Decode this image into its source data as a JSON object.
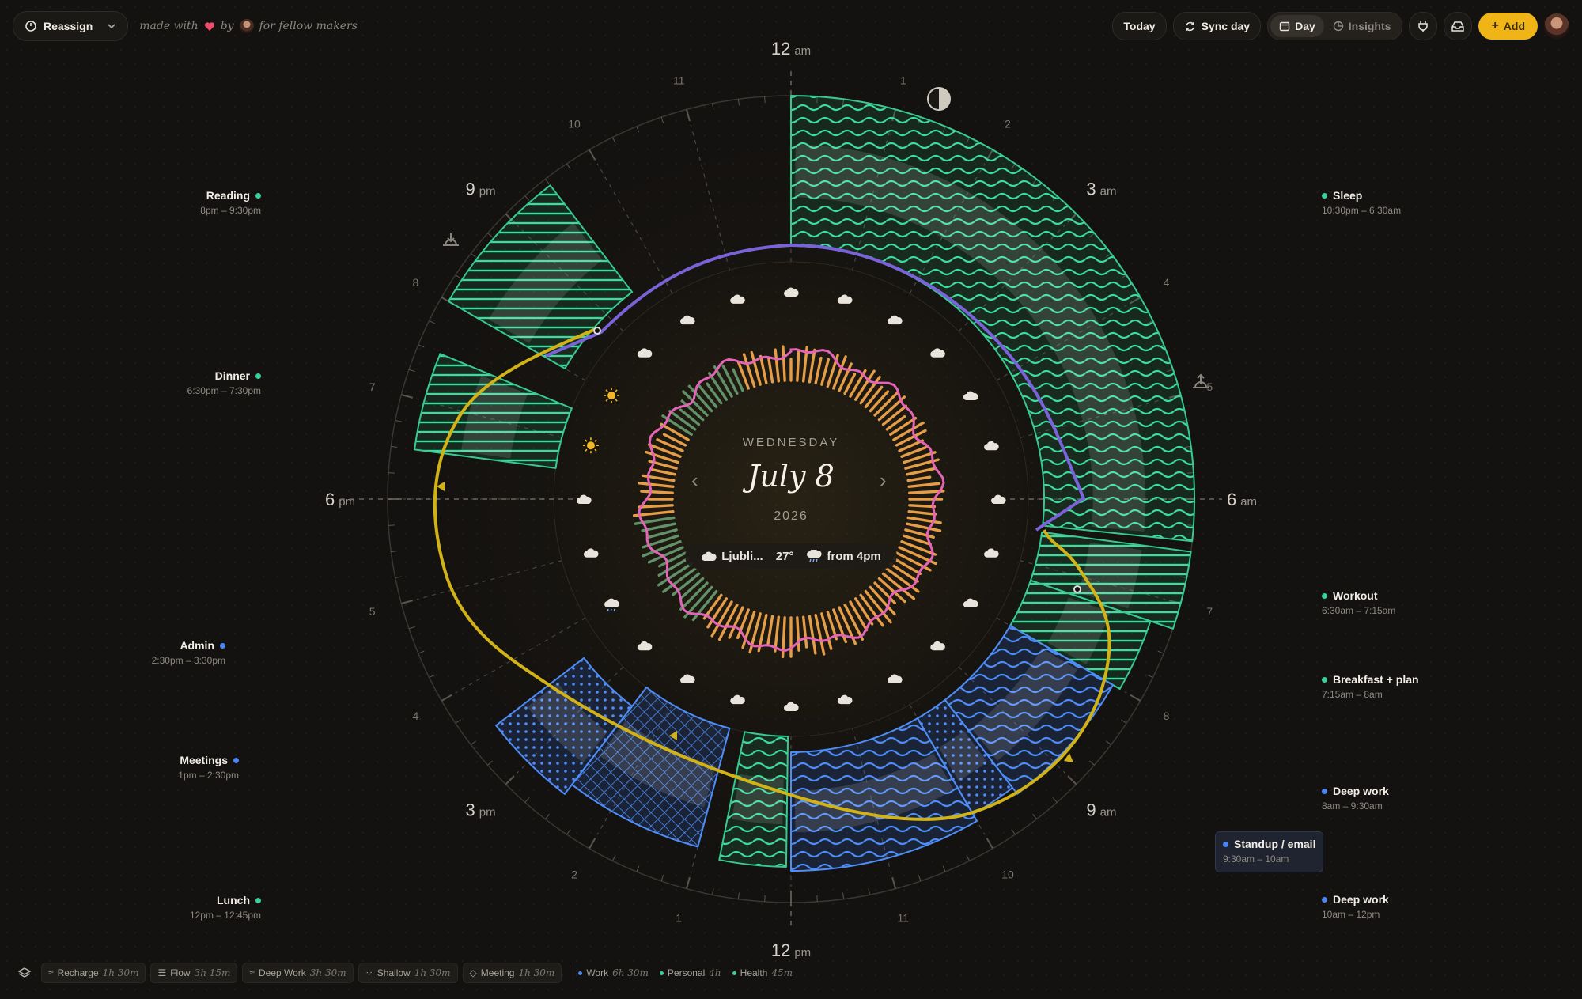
{
  "header": {
    "reassign_label": "Reassign",
    "made_with": "made with",
    "by": "by",
    "for_makers": "for fellow makers",
    "today_label": "Today",
    "sync_label": "Sync day",
    "view_day": "Day",
    "view_insights": "Insights",
    "add_label": "Add"
  },
  "clock": {
    "top_hour": "12",
    "top_suffix": "am",
    "bottom_hour": "12",
    "bottom_suffix": "pm",
    "right_hour": "6",
    "right_suffix": "am",
    "left_hour": "6",
    "left_suffix": "pm",
    "h3am": "3",
    "h3am_s": "am",
    "h9am": "9",
    "h9am_s": "am",
    "h3pm": "3",
    "h3pm_s": "pm",
    "h9pm": "9",
    "h9pm_s": "pm",
    "small_hours": [
      "1",
      "2",
      "4",
      "5",
      "7",
      "8",
      "10",
      "11",
      "1",
      "2",
      "4",
      "5",
      "7",
      "8",
      "10",
      "11"
    ]
  },
  "center": {
    "weekday": "WEDNESDAY",
    "date": "July 8",
    "year": "2026",
    "prev": "‹",
    "next": "›",
    "weather_city": "Ljubli...",
    "weather_temp": "27°",
    "weather_rain": "from 4pm"
  },
  "events": [
    {
      "title": "Reading",
      "time": "8pm – 9:30pm",
      "category": "Personal",
      "color": "#35d29a"
    },
    {
      "title": "Dinner",
      "time": "6:30pm – 7:30pm",
      "category": "Personal",
      "color": "#35d29a"
    },
    {
      "title": "Admin",
      "time": "2:30pm – 3:30pm",
      "category": "Work",
      "color": "#4b86f4"
    },
    {
      "title": "Meetings",
      "time": "1pm – 2:30pm",
      "category": "Work",
      "color": "#4b86f4"
    },
    {
      "title": "Lunch",
      "time": "12pm – 12:45pm",
      "category": "Personal",
      "color": "#35d29a"
    },
    {
      "title": "Sleep",
      "time": "10:30pm – 6:30am",
      "category": "Health",
      "color": "#35d29a"
    },
    {
      "title": "Workout",
      "time": "6:30am – 7:15am",
      "category": "Health",
      "color": "#35d29a"
    },
    {
      "title": "Breakfast + plan",
      "time": "7:15am – 8am",
      "category": "Personal",
      "color": "#35d29a"
    },
    {
      "title": "Deep work",
      "time": "8am – 9:30am",
      "category": "Work",
      "color": "#4b86f4"
    },
    {
      "title": "Standup / email",
      "time": "9:30am – 10am",
      "category": "Work",
      "color": "#4b86f4"
    },
    {
      "title": "Deep work",
      "time": "10am – 12pm",
      "category": "Work",
      "color": "#4b86f4"
    }
  ],
  "footer": {
    "chips": [
      {
        "label": "Recharge",
        "value": "1h 30m"
      },
      {
        "label": "Flow",
        "value": "3h 15m"
      },
      {
        "label": "Deep Work",
        "value": "3h 30m"
      },
      {
        "label": "Shallow",
        "value": "1h 30m"
      },
      {
        "label": "Meeting",
        "value": "1h 30m"
      }
    ],
    "legend": [
      {
        "label": "Work",
        "value": "6h 30m",
        "color": "#4b86f4"
      },
      {
        "label": "Personal",
        "value": "4h",
        "color": "#35d29a"
      },
      {
        "label": "Health",
        "value": "45m",
        "color": "#35d29a"
      }
    ]
  }
}
